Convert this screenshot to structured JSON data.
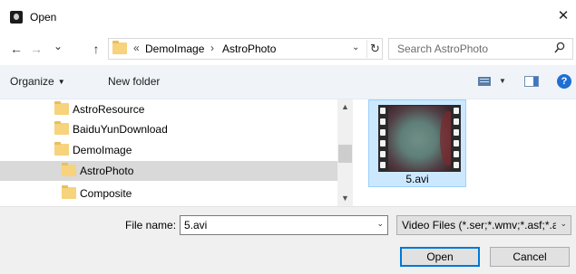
{
  "window": {
    "title": "Open",
    "close_glyph": "✕"
  },
  "nav": {
    "back_glyph": "←",
    "forward_glyph": "→",
    "recent_glyph": "⌄",
    "up_glyph": "↑",
    "address": {
      "overflow_glyph": "«",
      "separator": "›",
      "crumbs": [
        "DemoImage",
        "AstroPhoto"
      ],
      "dropdown_glyph": "⌄",
      "refresh_glyph": "↻"
    },
    "search_placeholder": "Search AstroPhoto"
  },
  "toolbar": {
    "organize_label": "Organize",
    "organize_caret": "▼",
    "new_folder_label": "New folder",
    "view_caret": "▼",
    "help_glyph": "?"
  },
  "tree": {
    "items": [
      {
        "label": "AstroResource"
      },
      {
        "label": "BaiduYunDownload"
      },
      {
        "label": "DemoImage"
      },
      {
        "label": "AstroPhoto",
        "selected": true
      },
      {
        "label": "Composite"
      }
    ],
    "scroll_up_glyph": "▲",
    "scroll_down_glyph": "▼"
  },
  "files": [
    {
      "name": "5.avi",
      "icon": "video-file-icon",
      "selected": true
    }
  ],
  "bottom": {
    "file_name_label": "File name:",
    "file_name_value": "5.avi",
    "file_name_dropdown_glyph": "⌄",
    "file_type_value": "Video Files (*.ser;*.wmv;*.asf;*.a",
    "file_type_dropdown_glyph": "⌄",
    "open_label": "Open",
    "cancel_label": "Cancel"
  },
  "colors": {
    "toolbar_bg": "#f0f4f9",
    "selected_tile": "#cce8ff",
    "selected_tree": "#d9d9d9",
    "accent": "#0078d7",
    "folder": "#f6d37c"
  }
}
